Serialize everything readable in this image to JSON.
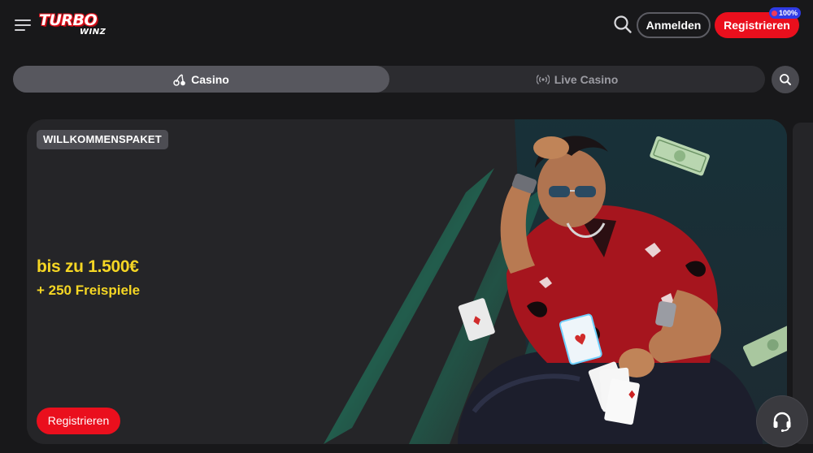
{
  "header": {
    "logo_top": "TURBO",
    "logo_bottom": "WINZ",
    "login_label": "Anmelden",
    "register_label": "Registrieren",
    "register_badge": "100%"
  },
  "tabs": [
    {
      "label": "Casino",
      "icon": "cherries-icon",
      "active": true
    },
    {
      "label": "Live Casino",
      "icon": "live-broadcast-icon",
      "active": false
    }
  ],
  "banner": {
    "badge": "WILLKOMMENSPAKET",
    "offer_main": "bis zu 1.500€",
    "offer_sub": "+ 250 Freispiele",
    "register_label": "Registrieren"
  },
  "colors": {
    "background": "#18181a",
    "accent_red": "#ea0f1d",
    "offer_yellow": "#f5d624",
    "badge_blue": "#2f3be5"
  }
}
